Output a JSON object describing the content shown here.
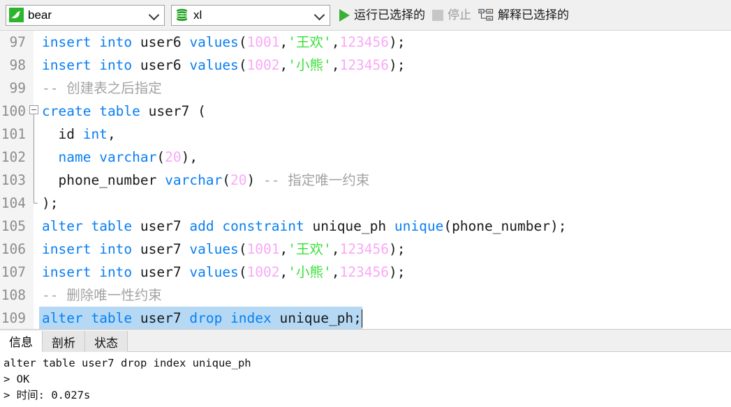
{
  "toolbar": {
    "connection": {
      "icon": "mysql-dolphin-icon",
      "value": "bear",
      "chevron": "chevron-down-icon"
    },
    "database": {
      "icon": "database-cylinder-icon",
      "value": "xl",
      "chevron": "chevron-down-icon"
    },
    "run_selected": {
      "icon": "play-icon",
      "label": "运行已选择的",
      "enabled": true
    },
    "stop": {
      "icon": "stop-square-icon",
      "label": "停止",
      "enabled": false
    },
    "explain_selected": {
      "icon": "explain-plan-icon",
      "label": "解释已选择的",
      "enabled": true
    }
  },
  "editor": {
    "lines": [
      {
        "n": "97",
        "fold": "none",
        "selected": false,
        "tokens": [
          {
            "t": "insert",
            "c": "kw"
          },
          {
            "t": " ",
            "c": "pl"
          },
          {
            "t": "into",
            "c": "kw"
          },
          {
            "t": " user6 ",
            "c": "pl"
          },
          {
            "t": "values",
            "c": "kw"
          },
          {
            "t": "(",
            "c": "pl"
          },
          {
            "t": "1001",
            "c": "num"
          },
          {
            "t": ",",
            "c": "pl"
          },
          {
            "t": "'王欢'",
            "c": "str"
          },
          {
            "t": ",",
            "c": "pl"
          },
          {
            "t": "123456",
            "c": "num"
          },
          {
            "t": ");",
            "c": "pl"
          }
        ]
      },
      {
        "n": "98",
        "fold": "none",
        "selected": false,
        "tokens": [
          {
            "t": "insert",
            "c": "kw"
          },
          {
            "t": " ",
            "c": "pl"
          },
          {
            "t": "into",
            "c": "kw"
          },
          {
            "t": " user6 ",
            "c": "pl"
          },
          {
            "t": "values",
            "c": "kw"
          },
          {
            "t": "(",
            "c": "pl"
          },
          {
            "t": "1002",
            "c": "num"
          },
          {
            "t": ",",
            "c": "pl"
          },
          {
            "t": "'小熊'",
            "c": "str"
          },
          {
            "t": ",",
            "c": "pl"
          },
          {
            "t": "123456",
            "c": "num"
          },
          {
            "t": ");",
            "c": "pl"
          }
        ]
      },
      {
        "n": "99",
        "fold": "none",
        "selected": false,
        "tokens": [
          {
            "t": "-- 创建表之后指定",
            "c": "cmt"
          }
        ]
      },
      {
        "n": "100",
        "fold": "start",
        "selected": false,
        "tokens": [
          {
            "t": "create",
            "c": "kw"
          },
          {
            "t": " ",
            "c": "pl"
          },
          {
            "t": "table",
            "c": "kw"
          },
          {
            "t": " user7 (",
            "c": "pl"
          }
        ]
      },
      {
        "n": "101",
        "fold": "mid",
        "selected": false,
        "tokens": [
          {
            "t": "  id ",
            "c": "pl"
          },
          {
            "t": "int",
            "c": "kw"
          },
          {
            "t": ",",
            "c": "pl"
          }
        ]
      },
      {
        "n": "102",
        "fold": "mid",
        "selected": false,
        "tokens": [
          {
            "t": "  ",
            "c": "pl"
          },
          {
            "t": "name",
            "c": "kw"
          },
          {
            "t": " ",
            "c": "pl"
          },
          {
            "t": "varchar",
            "c": "kw"
          },
          {
            "t": "(",
            "c": "pl"
          },
          {
            "t": "20",
            "c": "num"
          },
          {
            "t": "),",
            "c": "pl"
          }
        ]
      },
      {
        "n": "103",
        "fold": "mid",
        "selected": false,
        "tokens": [
          {
            "t": "  phone_number ",
            "c": "pl"
          },
          {
            "t": "varchar",
            "c": "kw"
          },
          {
            "t": "(",
            "c": "pl"
          },
          {
            "t": "20",
            "c": "num"
          },
          {
            "t": ") ",
            "c": "pl"
          },
          {
            "t": "-- 指定唯一约束",
            "c": "cmt"
          }
        ]
      },
      {
        "n": "104",
        "fold": "end",
        "selected": false,
        "tokens": [
          {
            "t": ");",
            "c": "pl"
          }
        ]
      },
      {
        "n": "105",
        "fold": "none",
        "selected": false,
        "tokens": [
          {
            "t": "alter",
            "c": "kw"
          },
          {
            "t": " ",
            "c": "pl"
          },
          {
            "t": "table",
            "c": "kw"
          },
          {
            "t": " user7 ",
            "c": "pl"
          },
          {
            "t": "add",
            "c": "kw"
          },
          {
            "t": " ",
            "c": "pl"
          },
          {
            "t": "constraint",
            "c": "kw"
          },
          {
            "t": " unique_ph ",
            "c": "pl"
          },
          {
            "t": "unique",
            "c": "kw"
          },
          {
            "t": "(phone_number);",
            "c": "pl"
          }
        ]
      },
      {
        "n": "106",
        "fold": "none",
        "selected": false,
        "tokens": [
          {
            "t": "insert",
            "c": "kw"
          },
          {
            "t": " ",
            "c": "pl"
          },
          {
            "t": "into",
            "c": "kw"
          },
          {
            "t": " user7 ",
            "c": "pl"
          },
          {
            "t": "values",
            "c": "kw"
          },
          {
            "t": "(",
            "c": "pl"
          },
          {
            "t": "1001",
            "c": "num"
          },
          {
            "t": ",",
            "c": "pl"
          },
          {
            "t": "'王欢'",
            "c": "str"
          },
          {
            "t": ",",
            "c": "pl"
          },
          {
            "t": "123456",
            "c": "num"
          },
          {
            "t": ");",
            "c": "pl"
          }
        ]
      },
      {
        "n": "107",
        "fold": "none",
        "selected": false,
        "tokens": [
          {
            "t": "insert",
            "c": "kw"
          },
          {
            "t": " ",
            "c": "pl"
          },
          {
            "t": "into",
            "c": "kw"
          },
          {
            "t": " user7 ",
            "c": "pl"
          },
          {
            "t": "values",
            "c": "kw"
          },
          {
            "t": "(",
            "c": "pl"
          },
          {
            "t": "1002",
            "c": "num"
          },
          {
            "t": ",",
            "c": "pl"
          },
          {
            "t": "'小熊'",
            "c": "str"
          },
          {
            "t": ",",
            "c": "pl"
          },
          {
            "t": "123456",
            "c": "num"
          },
          {
            "t": ");",
            "c": "pl"
          }
        ]
      },
      {
        "n": "108",
        "fold": "none",
        "selected": false,
        "tokens": [
          {
            "t": "-- 删除唯一性约束",
            "c": "cmt"
          }
        ]
      },
      {
        "n": "109",
        "fold": "none",
        "selected": true,
        "caret": true,
        "tokens": [
          {
            "t": "alter",
            "c": "kw"
          },
          {
            "t": " ",
            "c": "pl"
          },
          {
            "t": "table",
            "c": "kw"
          },
          {
            "t": " user7 ",
            "c": "pl"
          },
          {
            "t": "drop",
            "c": "kw"
          },
          {
            "t": " ",
            "c": "pl"
          },
          {
            "t": "index",
            "c": "kw"
          },
          {
            "t": " unique_ph;",
            "c": "pl"
          }
        ]
      }
    ]
  },
  "bottom": {
    "tabs": [
      {
        "label": "信息",
        "active": true
      },
      {
        "label": "剖析",
        "active": false
      },
      {
        "label": "状态",
        "active": false
      }
    ],
    "output": "alter table user7 drop index unique_ph\n> OK\n> 时间: 0.027s"
  },
  "colors": {
    "keyword": "#0a7ff2",
    "number": "#f9a9f7",
    "string": "#3ae03a",
    "comment": "#a3a3a3",
    "selection": "#b5d9f5",
    "accent_green": "#2ab52a"
  }
}
